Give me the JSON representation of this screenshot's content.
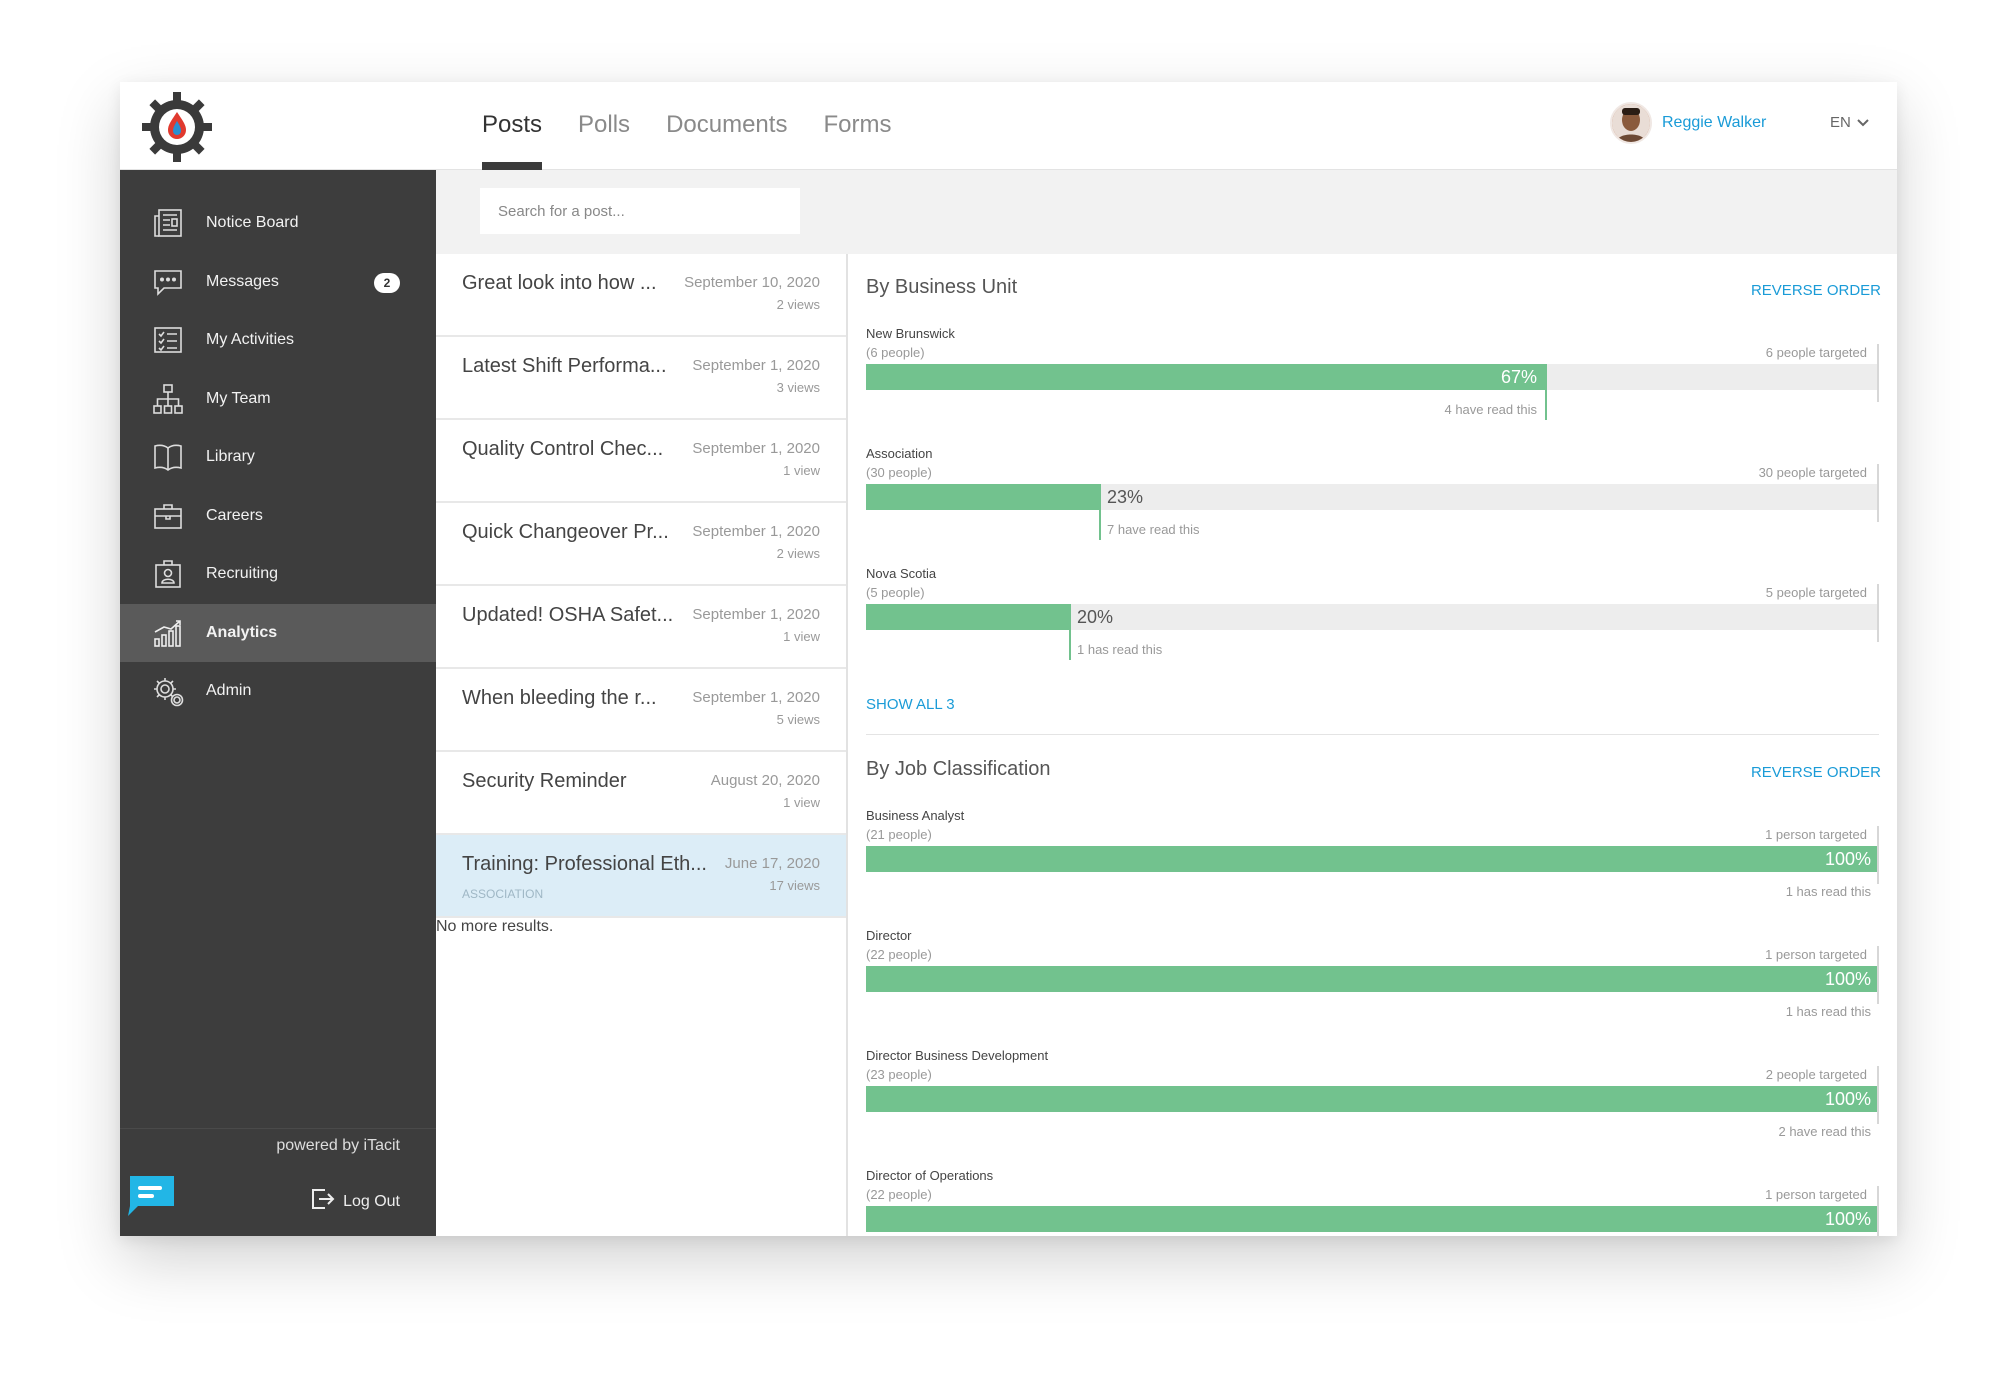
{
  "header": {
    "tabs": [
      {
        "label": "Posts",
        "active": true
      },
      {
        "label": "Polls",
        "active": false
      },
      {
        "label": "Documents",
        "active": false
      },
      {
        "label": "Forms",
        "active": false
      }
    ],
    "user_name": "Reggie Walker",
    "language": "EN"
  },
  "sidebar": {
    "items": [
      {
        "label": "Notice Board",
        "icon": "newspaper-icon"
      },
      {
        "label": "Messages",
        "icon": "chat-icon",
        "badge": "2"
      },
      {
        "label": "My Activities",
        "icon": "checklist-icon"
      },
      {
        "label": "My Team",
        "icon": "org-chart-icon"
      },
      {
        "label": "Library",
        "icon": "book-icon"
      },
      {
        "label": "Careers",
        "icon": "briefcase-icon"
      },
      {
        "label": "Recruiting",
        "icon": "id-badge-icon"
      },
      {
        "label": "Analytics",
        "icon": "bar-chart-icon",
        "active": true
      },
      {
        "label": "Admin",
        "icon": "gear-icon"
      }
    ],
    "powered_by": "powered by iTacit",
    "logout_label": "Log Out"
  },
  "search": {
    "placeholder": "Search for a post..."
  },
  "posts": [
    {
      "title": "Great look into how ...",
      "date": "September 10, 2020",
      "views": "2 views"
    },
    {
      "title": "Latest Shift Performa...",
      "date": "September 1, 2020",
      "views": "3 views"
    },
    {
      "title": "Quality Control Chec...",
      "date": "September 1, 2020",
      "views": "1 view"
    },
    {
      "title": "Quick Changeover Pr...",
      "date": "September 1, 2020",
      "views": "2 views"
    },
    {
      "title": "Updated! OSHA Safet...",
      "date": "September 1, 2020",
      "views": "1 view"
    },
    {
      "title": "When bleeding the r...",
      "date": "September 1, 2020",
      "views": "5 views"
    },
    {
      "title": "Security Reminder",
      "date": "August 20, 2020",
      "views": "1 view"
    },
    {
      "title": "Training: Professional Eth...",
      "date": "June 17, 2020",
      "views": "17 views",
      "tag": "ASSOCIATION",
      "selected": true
    }
  ],
  "no_more_results": "No more results.",
  "analytics": {
    "business_unit": {
      "title": "By Business Unit",
      "reverse_label": "REVERSE ORDER",
      "show_all_label": "SHOW ALL 3",
      "rows": [
        {
          "name": "New Brunswick",
          "people": "(6 people)",
          "targeted": "6 people targeted",
          "percent_label": "67%",
          "percent": 67,
          "read": "4 have read this"
        },
        {
          "name": "Association",
          "people": "(30 people)",
          "targeted": "30 people targeted",
          "percent_label": "23%",
          "percent": 23,
          "read": "7 have read this"
        },
        {
          "name": "Nova Scotia",
          "people": "(5 people)",
          "targeted": "5 people targeted",
          "percent_label": "20%",
          "percent": 20,
          "read": "1 has read this"
        }
      ]
    },
    "job_classification": {
      "title": "By Job Classification",
      "reverse_label": "REVERSE ORDER",
      "rows": [
        {
          "name": "Business Analyst",
          "people": "(21 people)",
          "targeted": "1 person targeted",
          "percent_label": "100%",
          "percent": 100,
          "read": "1 has read this"
        },
        {
          "name": "Director",
          "people": "(22 people)",
          "targeted": "1 person targeted",
          "percent_label": "100%",
          "percent": 100,
          "read": "1 has read this"
        },
        {
          "name": "Director Business Development",
          "people": "(23 people)",
          "targeted": "2 people targeted",
          "percent_label": "100%",
          "percent": 100,
          "read": "2 have read this"
        },
        {
          "name": "Director of Operations",
          "people": "(22 people)",
          "targeted": "1 person targeted",
          "percent_label": "100%",
          "percent": 100,
          "read": ""
        }
      ]
    }
  },
  "colors": {
    "accent": "#1a9bd7",
    "bar": "#72c28e",
    "sidebar": "#3d3d3d"
  }
}
